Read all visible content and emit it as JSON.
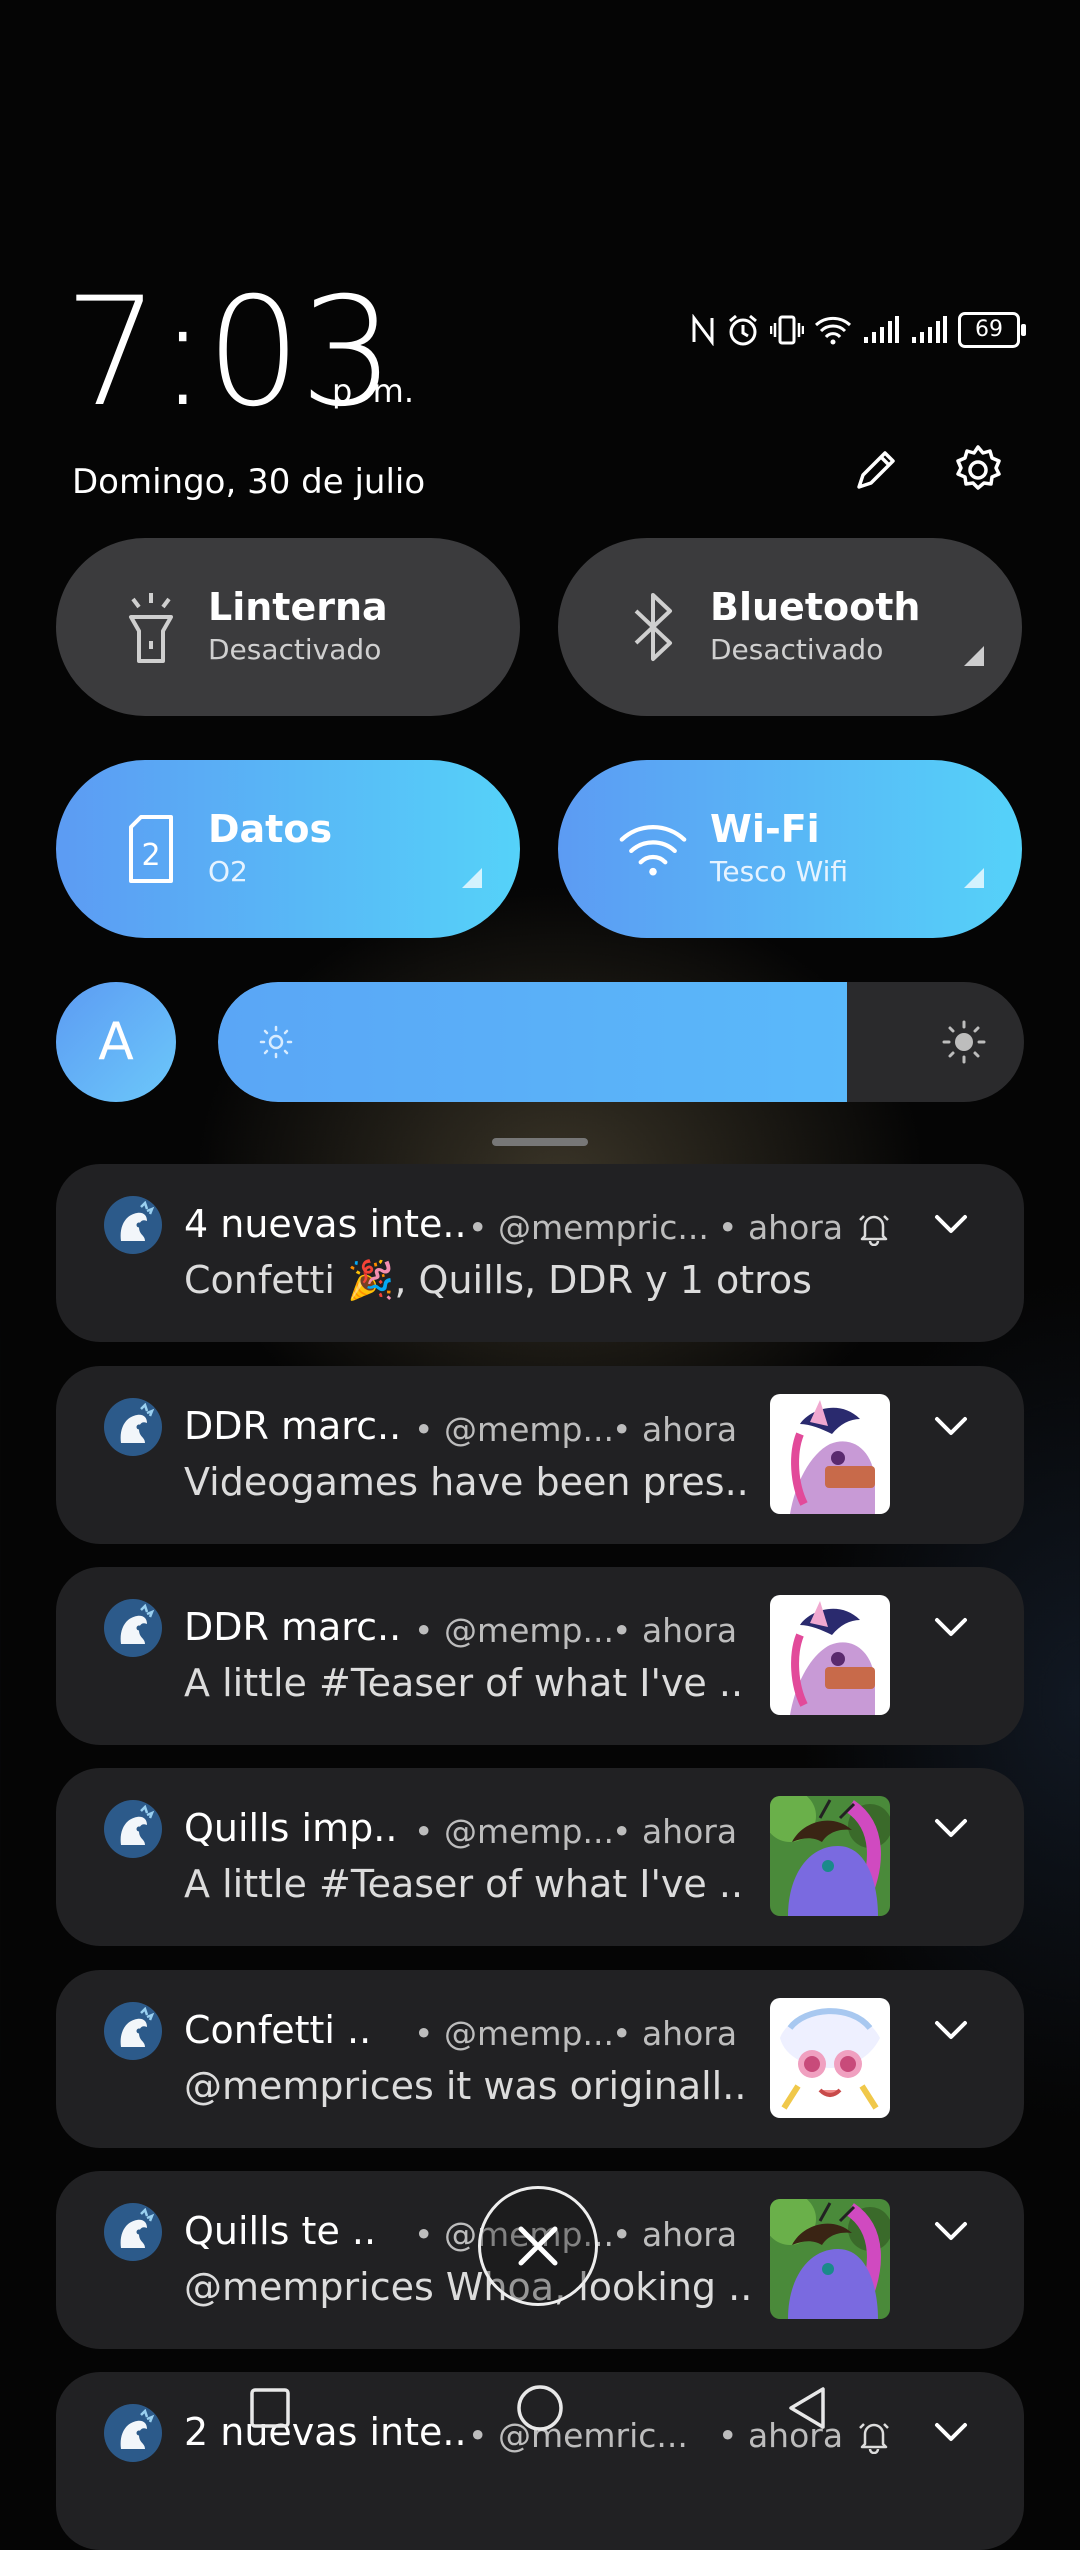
{
  "header": {
    "time": "7:03",
    "ampm": "p. m.",
    "date": "Domingo, 30 de julio",
    "battery": "69"
  },
  "tiles": [
    {
      "title": "Linterna",
      "subtitle": "Desactivado",
      "state": "off",
      "icon": "flashlight-icon"
    },
    {
      "title": "Bluetooth",
      "subtitle": "Desactivado",
      "state": "off",
      "icon": "bluetooth-icon"
    },
    {
      "title": "Datos",
      "subtitle": "O2",
      "state": "on",
      "icon": "sim-card-icon"
    },
    {
      "title": "Wi-Fi",
      "subtitle": "Tesco Wifi",
      "state": "on",
      "icon": "wifi-icon"
    }
  ],
  "brightness": {
    "auto_label": "A",
    "level": 0.78
  },
  "notifications": [
    {
      "title": "4 nuevas inte..",
      "handle": "• @mempric...",
      "time": "• ahora",
      "body": "Confetti 🎉, Quills, DDR y 1 otros",
      "bell": true,
      "thumb": ""
    },
    {
      "title": "DDR marc..",
      "handle": "• @memp...",
      "time": "• ahora",
      "body": "Videogames have been pres..",
      "bell": false,
      "thumb": "twilight"
    },
    {
      "title": "DDR marc..",
      "handle": "• @memp...",
      "time": "• ahora",
      "body": "A little #Teaser of what I've ..",
      "bell": false,
      "thumb": "twilight"
    },
    {
      "title": "Quills imp..",
      "handle": "• @memp...",
      "time": "• ahora",
      "body": "A little #Teaser of what I've ..",
      "bell": false,
      "thumb": "quills"
    },
    {
      "title": "Confetti ..",
      "handle": "• @memp...",
      "time": "• ahora",
      "body": "@memprices it was originall..",
      "bell": false,
      "thumb": "confetti"
    },
    {
      "title": "Quills te ..",
      "handle": "• @memp...",
      "time": "• ahora",
      "body": "@memprices Whoa, looking ..",
      "bell": false,
      "thumb": "quills"
    },
    {
      "title": "2 nuevas inte..",
      "handle": "• @memric...",
      "time": "• ahora",
      "body": "",
      "bell": true,
      "thumb": ""
    }
  ],
  "colors": {
    "accent": "#5c9bf3",
    "accent_light": "#55d2f9",
    "tile_off": "#3b3b3d",
    "card": "#212123"
  }
}
